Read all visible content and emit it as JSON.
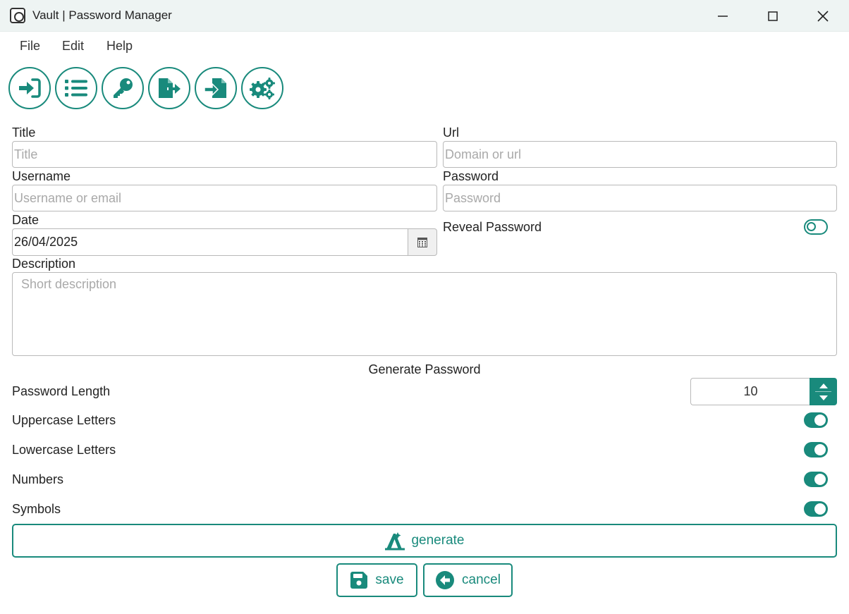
{
  "window": {
    "title": "Vault | Password Manager",
    "controls": [
      "minimize",
      "maximize",
      "close"
    ]
  },
  "menu": [
    "File",
    "Edit",
    "Help"
  ],
  "toolbar": {
    "icons": [
      "login-icon",
      "list-icon",
      "key-icon",
      "export-icon",
      "import-icon",
      "settings-icon"
    ]
  },
  "form": {
    "title_label": "Title",
    "title_placeholder": "Title",
    "url_label": "Url",
    "url_placeholder": "Domain or url",
    "username_label": "Username",
    "username_placeholder": "Username or email",
    "password_label": "Password",
    "password_placeholder": "Password",
    "date_label": "Date",
    "date_value": "26/04/2025",
    "reveal_label": "Reveal Password",
    "reveal_on": false,
    "description_label": "Description",
    "description_placeholder": "Short description"
  },
  "generator": {
    "section_title": "Generate Password",
    "length_label": "Password Length",
    "length_value": "10",
    "uppercase_label": "Uppercase Letters",
    "uppercase_on": true,
    "lowercase_label": "Lowercase Letters",
    "lowercase_on": true,
    "numbers_label": "Numbers",
    "numbers_on": true,
    "symbols_label": "Symbols",
    "symbols_on": true,
    "generate_label": "generate"
  },
  "actions": {
    "save_label": "save",
    "cancel_label": "cancel"
  },
  "colors": {
    "accent": "#198a7c",
    "border": "#b9b9b9",
    "placeholder": "#a9a9a9"
  }
}
